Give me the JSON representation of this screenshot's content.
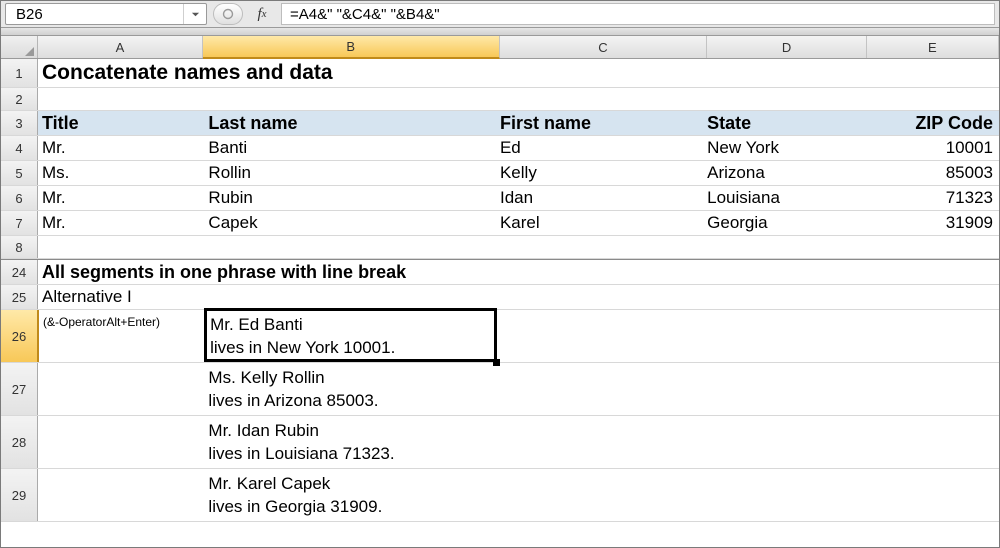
{
  "namebox": {
    "value": "B26"
  },
  "formula_bar": {
    "fx_label": "fx",
    "formula": "=A4&\" \"&C4&\" \"&B4&\""
  },
  "columns": [
    "A",
    "B",
    "C",
    "D",
    "E"
  ],
  "selected_col": "B",
  "selected_row": "26",
  "title": "Concatenate names and data",
  "headers": {
    "A": "Title",
    "B": "Last name",
    "C": "First name",
    "D": "State",
    "E": "ZIP Code"
  },
  "rows": [
    {
      "n": "4",
      "A": "Mr.",
      "B": "Banti",
      "C": "Ed",
      "D": "New York",
      "E": "10001"
    },
    {
      "n": "5",
      "A": "Ms.",
      "B": "Rollin",
      "C": "Kelly",
      "D": "Arizona",
      "E": "85003"
    },
    {
      "n": "6",
      "A": "Mr.",
      "B": "Rubin",
      "C": "Idan",
      "D": "Louisiana",
      "E": "71323"
    },
    {
      "n": "7",
      "A": "Mr.",
      "B": "Capek",
      "C": "Karel",
      "D": "Georgia",
      "E": "31909"
    }
  ],
  "section2": {
    "row24": "All segments in one phrase with line break",
    "row25": "Alternative I",
    "row26A_l1": "(&-Operator",
    "row26A_l2": "Alt+Enter)"
  },
  "results": {
    "r26": "Mr. Ed Banti\nlives in New York 10001.",
    "r27": "Ms. Kelly Rollin\nlives in Arizona 85003.",
    "r28": "Mr. Idan Rubin\nlives in Louisiana 71323.",
    "r29": "Mr. Karel Capek\nlives in Georgia 31909."
  },
  "chart_data": {
    "type": "table",
    "title": "Concatenate names and data",
    "columns": [
      "Title",
      "Last name",
      "First name",
      "State",
      "ZIP Code"
    ],
    "rows": [
      [
        "Mr.",
        "Banti",
        "Ed",
        "New York",
        10001
      ],
      [
        "Ms.",
        "Rollin",
        "Kelly",
        "Arizona",
        85003
      ],
      [
        "Mr.",
        "Rubin",
        "Idan",
        "Louisiana",
        71323
      ],
      [
        "Mr.",
        "Capek",
        "Karel",
        "Georgia",
        31909
      ]
    ]
  }
}
